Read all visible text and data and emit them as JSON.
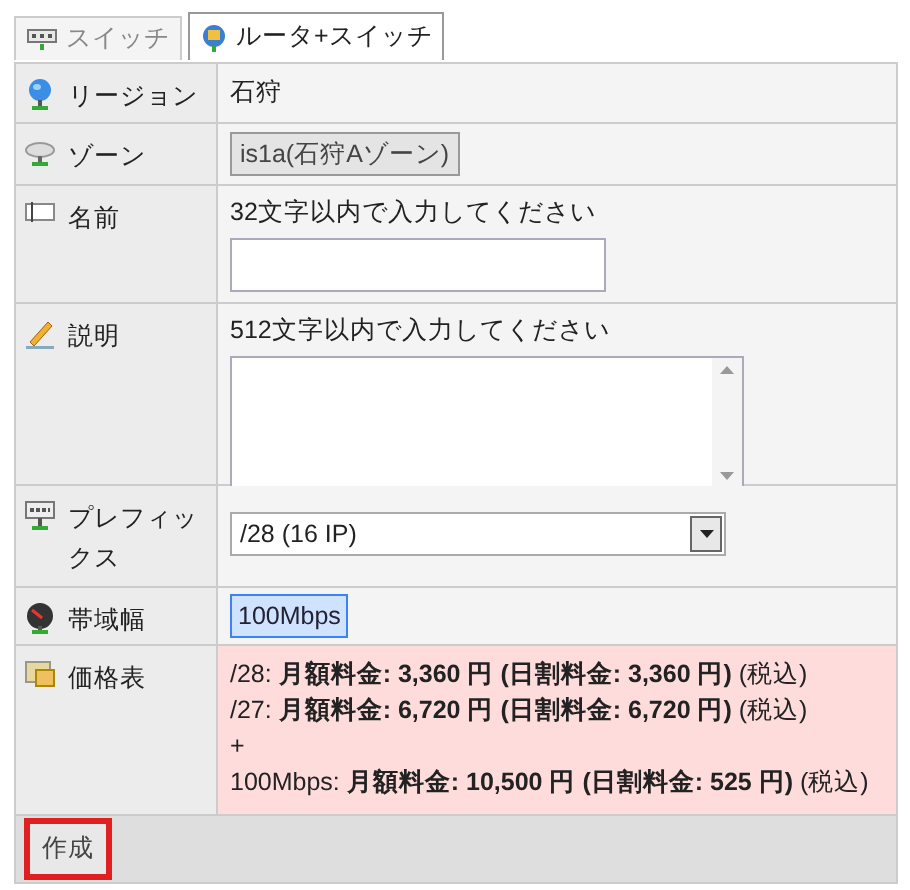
{
  "tabs": [
    {
      "label": "スイッチ",
      "kind": "switch",
      "selected": false
    },
    {
      "label": "ルータ+スイッチ",
      "kind": "router",
      "selected": true
    }
  ],
  "rows": [
    {
      "kind": "text",
      "label": "リージョン",
      "value": "石狩"
    },
    {
      "kind": "zone",
      "label": "ゾーン",
      "value": "is1a(石狩Aゾーン)"
    },
    {
      "kind": "input",
      "label": "名前",
      "hint": "32文字以内で入力してください"
    },
    {
      "kind": "textarea",
      "label": "説明",
      "hint": "512文字以内で入力してください"
    },
    {
      "kind": "select",
      "label": "プレフィックス",
      "value": "/28 (16 IP)"
    },
    {
      "kind": "options",
      "label": "帯域幅",
      "options": [
        {
          "label": "100Mbps",
          "selected": true
        }
      ]
    },
    {
      "kind": "price",
      "label": "価格表",
      "lines": [
        "/28: **月額料金: 3,360 円 (日割料金: 3,360 円)** (税込)",
        "/27: **月額料金: 6,720 円 (日割料金: 6,720 円)** (税込)",
        "+",
        "100Mbps: **月額料金: 10,500 円 (日割料金: 525 円)** (税込)"
      ]
    }
  ],
  "create_button": "作成"
}
